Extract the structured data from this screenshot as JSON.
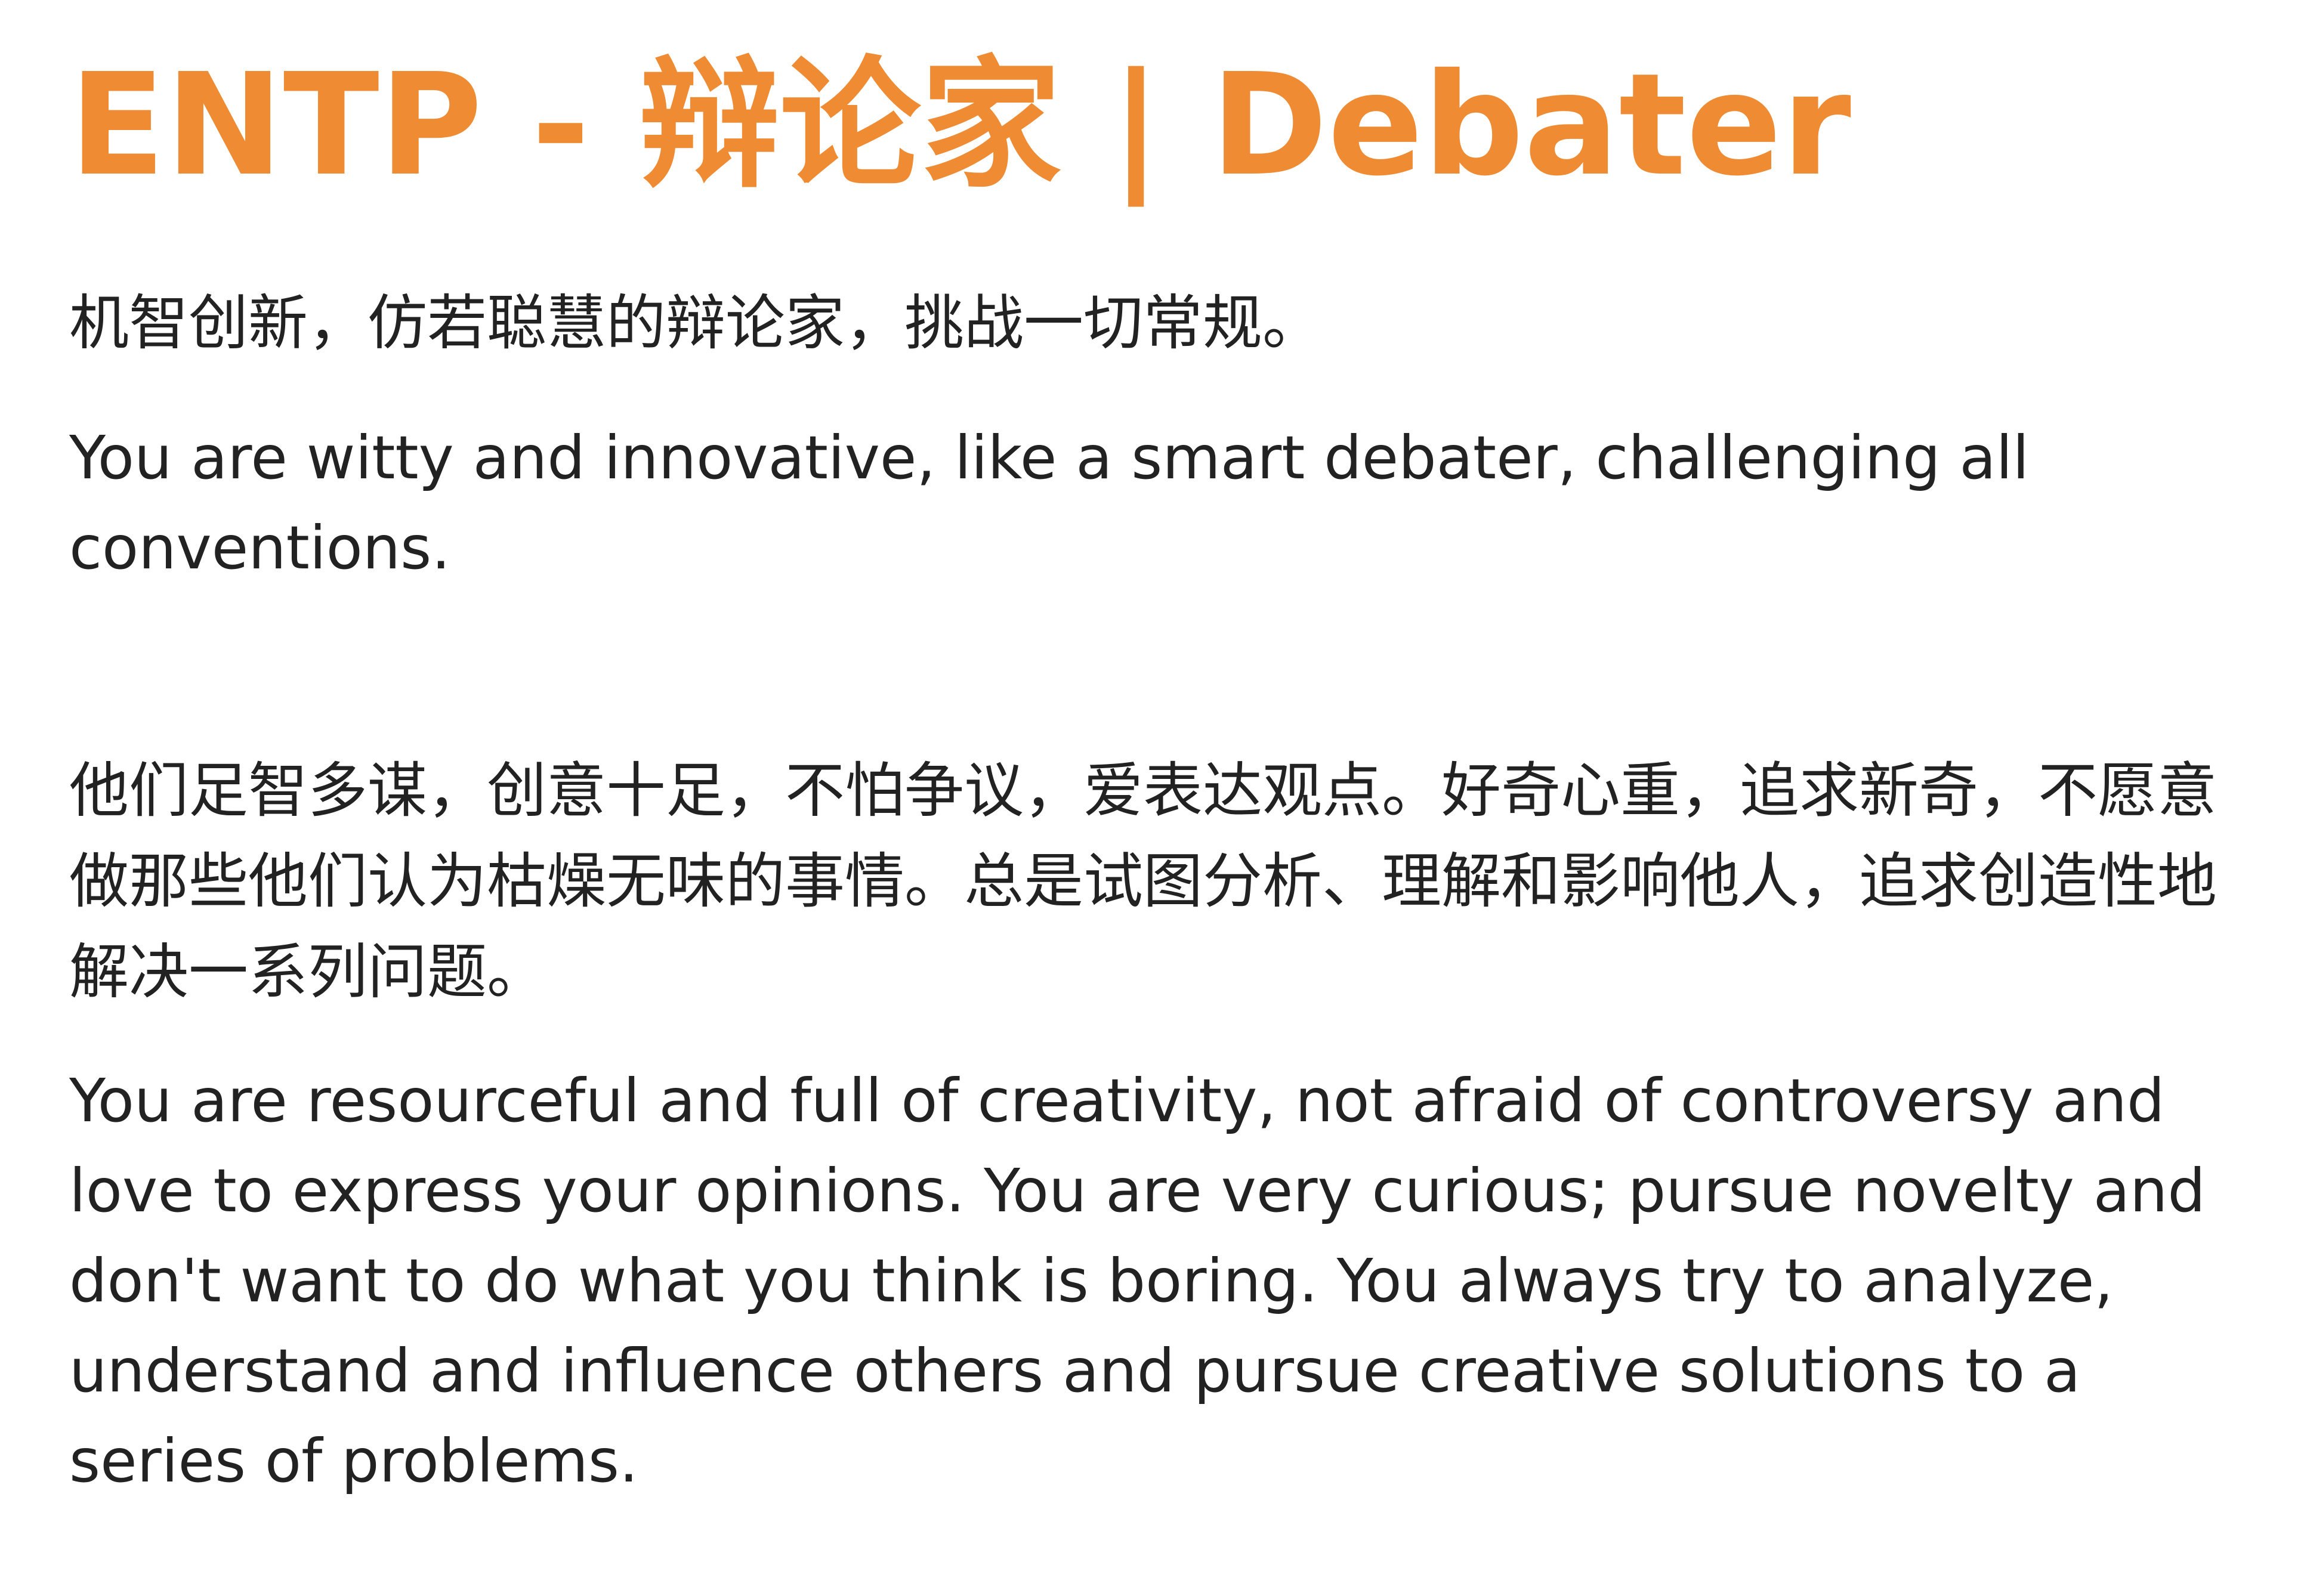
{
  "title": "ENTP - 辩论家 | Debater",
  "intro": {
    "zh": "机智创新，仿若聪慧的辩论家，挑战一切常规。",
    "en": "You are witty and innovative, like a smart debater, challenging all conventions."
  },
  "description": {
    "zh": "他们足智多谋，创意十足，不怕争议，爱表达观点。好奇心重，追求新奇，不愿意做那些他们认为枯燥无味的事情。总是试图分析、理解和影响他人，追求创造性地解决一系列问题。",
    "en": "You are resourceful and full of creativity, not afraid of controversy and love to express your opinions. You are very curious; pursue novelty and don't want to do what you think is boring. You always try to analyze, understand and influence others and pursue creative solutions to a series of problems."
  },
  "colors": {
    "title": "#EE8B33",
    "body_text": "#222222",
    "background": "#FFFFFF"
  }
}
